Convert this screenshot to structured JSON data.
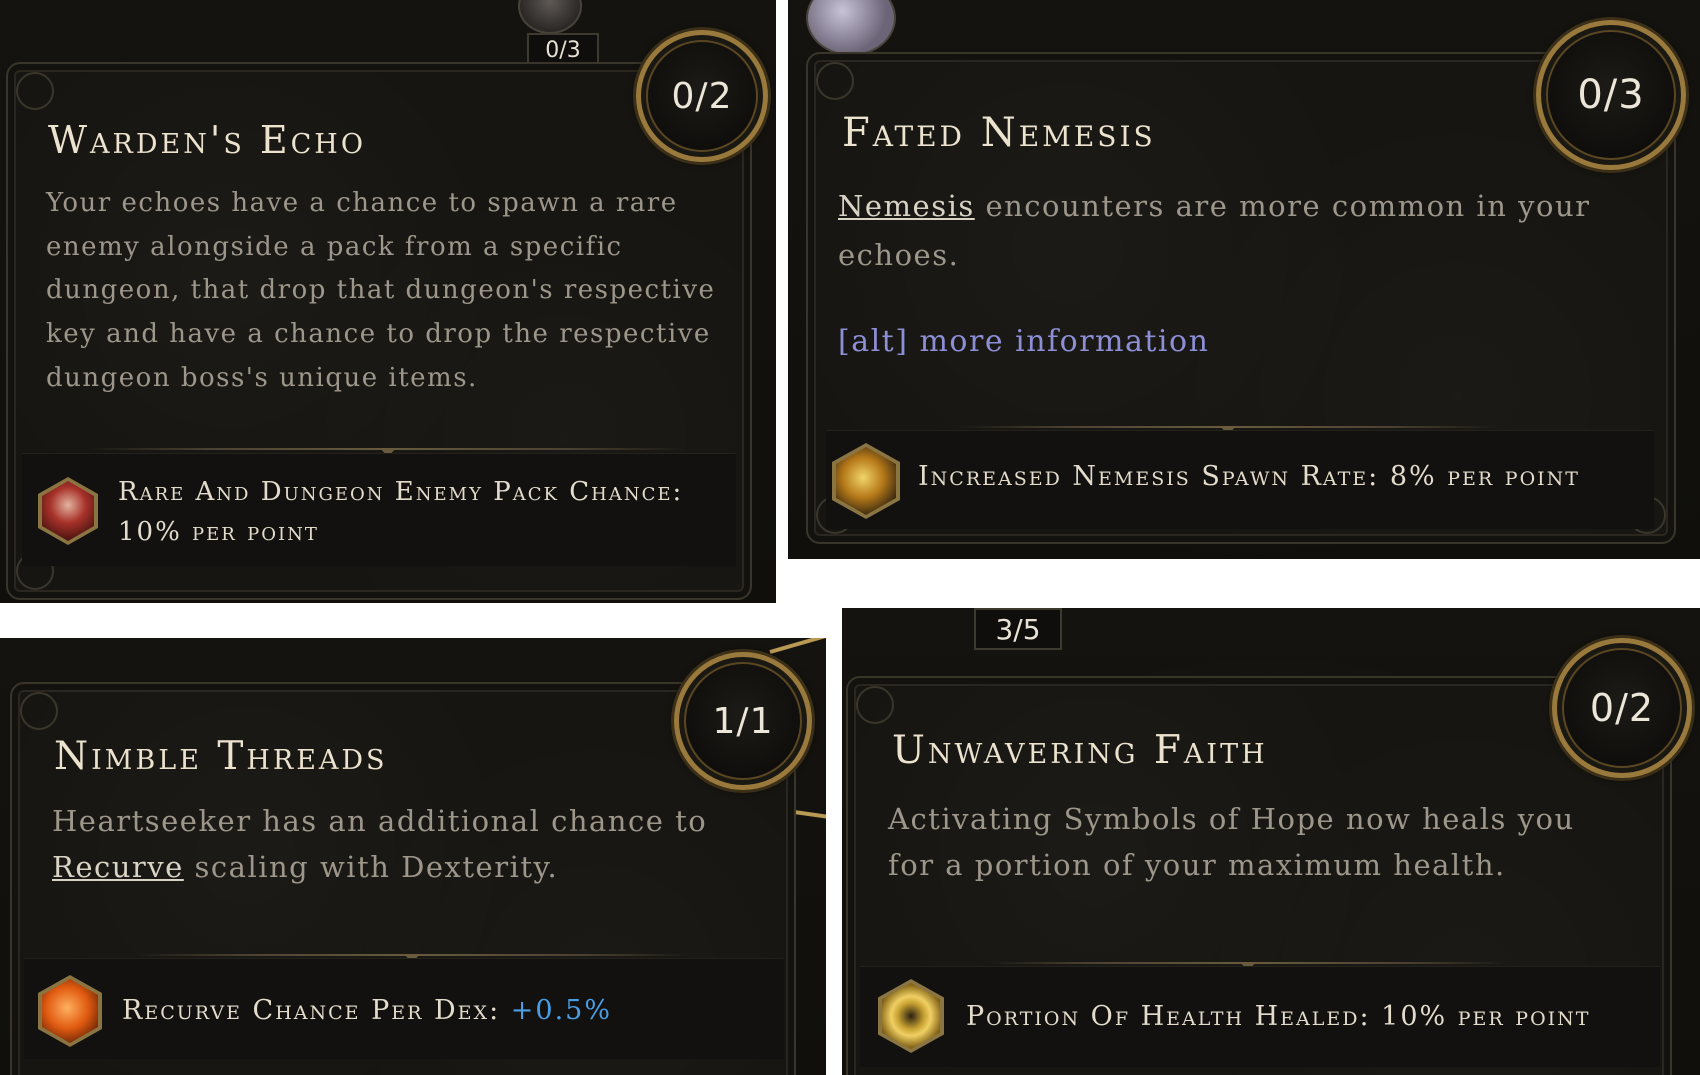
{
  "cards": [
    {
      "title": "Warden's Echo",
      "points": "0/2",
      "badge": "0/3",
      "desc": "Your echoes have a chance to spawn a rare enemy alongside a pack from a specific dungeon, that drop that dungeon's respective key and have a chance to drop the respective dungeon boss's unique items.",
      "stat": "Rare And Dungeon Enemy Pack Chance: 10% per point",
      "stat_icon": "cultist-portrait-icon"
    },
    {
      "title": "Fated Nemesis",
      "points": "0/3",
      "desc_keyword": "Nemesis",
      "desc_rest": " encounters are more common in your echoes.",
      "alt_info": "[alt] more information",
      "stat": "Increased Nemesis Spawn Rate: 8% per point",
      "stat_icon": "nemesis-beast-icon"
    },
    {
      "title": "Nimble Threads",
      "points": "1/1",
      "desc_pre": "Heartseeker has an additional chance to ",
      "desc_keyword": "Recurve",
      "desc_post": " scaling with Dexterity.",
      "stat_label": "Recurve Chance Per Dex: ",
      "stat_value": "+0.5%",
      "stat_icon": "recurve-arrow-icon"
    },
    {
      "title": "Unwavering Faith",
      "points": "0/2",
      "badge": "3/5",
      "desc": "Activating Symbols of Hope now heals you for a portion of your maximum health.",
      "stat": "Portion Of Health Healed: 10% per point",
      "stat_icon": "symbol-of-hope-icon"
    }
  ]
}
